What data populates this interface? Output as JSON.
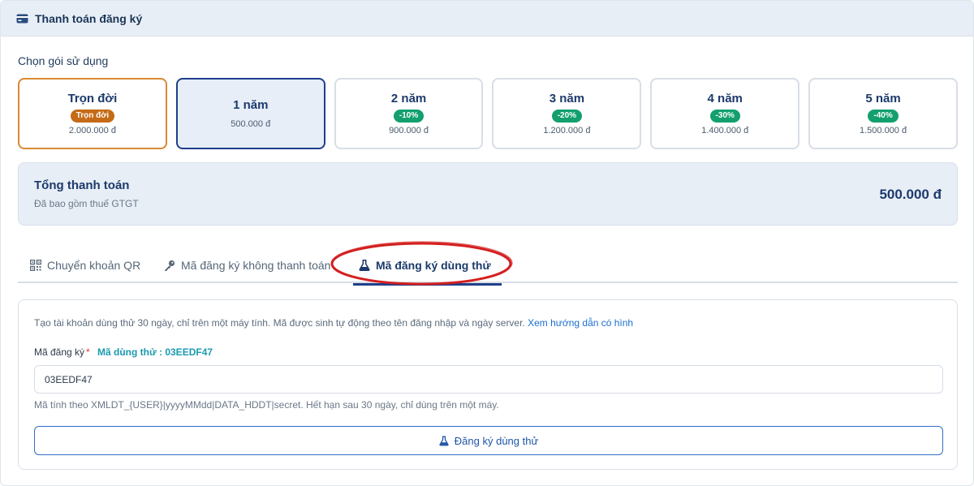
{
  "header": {
    "title": "Thanh toán đăng ký",
    "icon": "credit-card-icon"
  },
  "plans_section": {
    "label": "Chọn gói sử dụng",
    "plans": [
      {
        "name": "Trọn đời",
        "badge": "Trọn đời",
        "price": "2.000.000 đ",
        "state": "lifetime"
      },
      {
        "name": "1 năm",
        "badge": "",
        "price": "500.000 đ",
        "state": "selected"
      },
      {
        "name": "2 năm",
        "badge": "-10%",
        "price": "900.000 đ",
        "state": "default"
      },
      {
        "name": "3 năm",
        "badge": "-20%",
        "price": "1.200.000 đ",
        "state": "default"
      },
      {
        "name": "4 năm",
        "badge": "-30%",
        "price": "1.400.000 đ",
        "state": "default"
      },
      {
        "name": "5 năm",
        "badge": "-40%",
        "price": "1.500.000 đ",
        "state": "default"
      }
    ]
  },
  "total": {
    "title": "Tổng thanh toán",
    "subtitle": "Đã bao gồm thuế GTGT",
    "amount": "500.000 đ"
  },
  "tabs": [
    {
      "label": "Chuyển khoản QR",
      "icon": "qr-code-icon",
      "active": false
    },
    {
      "label": "Mã đăng ký không thanh toán",
      "icon": "key-icon",
      "active": false
    },
    {
      "label": "Mã đăng ký dùng thử",
      "icon": "flask-icon",
      "active": true
    }
  ],
  "trial_panel": {
    "description": "Tạo tài khoản dùng thử 30 ngày, chỉ trên một máy tính. Mã được sinh tự động theo tên đăng nhập và ngày server.",
    "guide_link": "Xem hướng dẫn có hình",
    "field_label": "Mã đăng ký",
    "required_mark": "*",
    "trial_code_hint": "Mã dùng thử : 03EEDF47",
    "code_value": "03EEDF47",
    "note": "Mã tính theo XMLDT_{USER}|yyyyMMdd|DATA_HDDT|secret. Hết hạn sau 30 ngày, chỉ dùng trên một máy.",
    "submit_label": "Đăng ký dùng thử"
  },
  "colors": {
    "accent": "#1f3f8a",
    "discount_badge": "#13a06e",
    "lifetime_badge": "#c56a16",
    "annotation_ellipse": "#d42020"
  }
}
